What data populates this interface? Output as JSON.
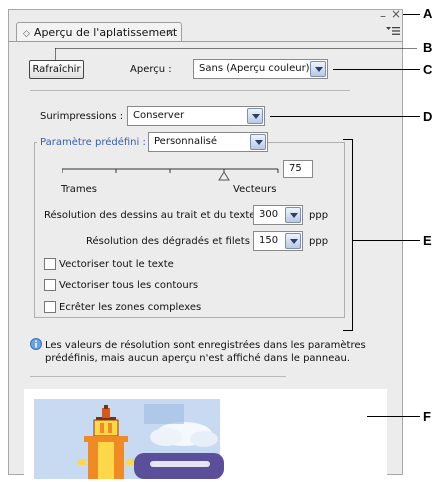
{
  "panel": {
    "tab_title": "Aperçu de l'aplatissement",
    "tab_glyph": "◇",
    "tab_close": "×",
    "window_minimize": "–",
    "window_close": "×",
    "menu_icon": "panel-menu-icon"
  },
  "toolbar": {
    "refresh_label": "Rafraîchir",
    "preview_label": "Aperçu :",
    "preview_value": "Sans (Aperçu couleur)"
  },
  "overprint": {
    "label": "Surimpressions :",
    "value": "Conserver"
  },
  "preset": {
    "label": "Paramètre prédéfini :",
    "value": "Personnalisé",
    "slider_value": "75",
    "slider_level": 0.75,
    "left_label": "Trames",
    "right_label": "Vecteurs",
    "line_art_label": "Résolution des dessins au trait et du texte :",
    "line_art_value": "300",
    "line_art_unit": "ppp",
    "gradient_label": "Résolution des dégradés et filets :",
    "gradient_value": "150",
    "gradient_unit": "ppp",
    "checkboxes": [
      {
        "label": "Vectoriser tout le texte",
        "checked": false
      },
      {
        "label": "Vectoriser tous les contours",
        "checked": false
      },
      {
        "label": "Ecrêter les zones complexes",
        "checked": false
      }
    ]
  },
  "info": {
    "icon": "info-icon",
    "line1": "Les valeurs de résolution sont enregistrées dans les paramètres",
    "line2": "prédéfinis, mais aucun aperçu n'est affiché dans le panneau."
  },
  "callouts": [
    "A",
    "B",
    "C",
    "D",
    "E",
    "F"
  ],
  "colors": {
    "panel_bg": "#ececec",
    "preset_label": "#3a5fa8",
    "sky": "#bcd3ee",
    "tower_orange": "#f08a24",
    "tower_yellow": "#ffd84a"
  }
}
